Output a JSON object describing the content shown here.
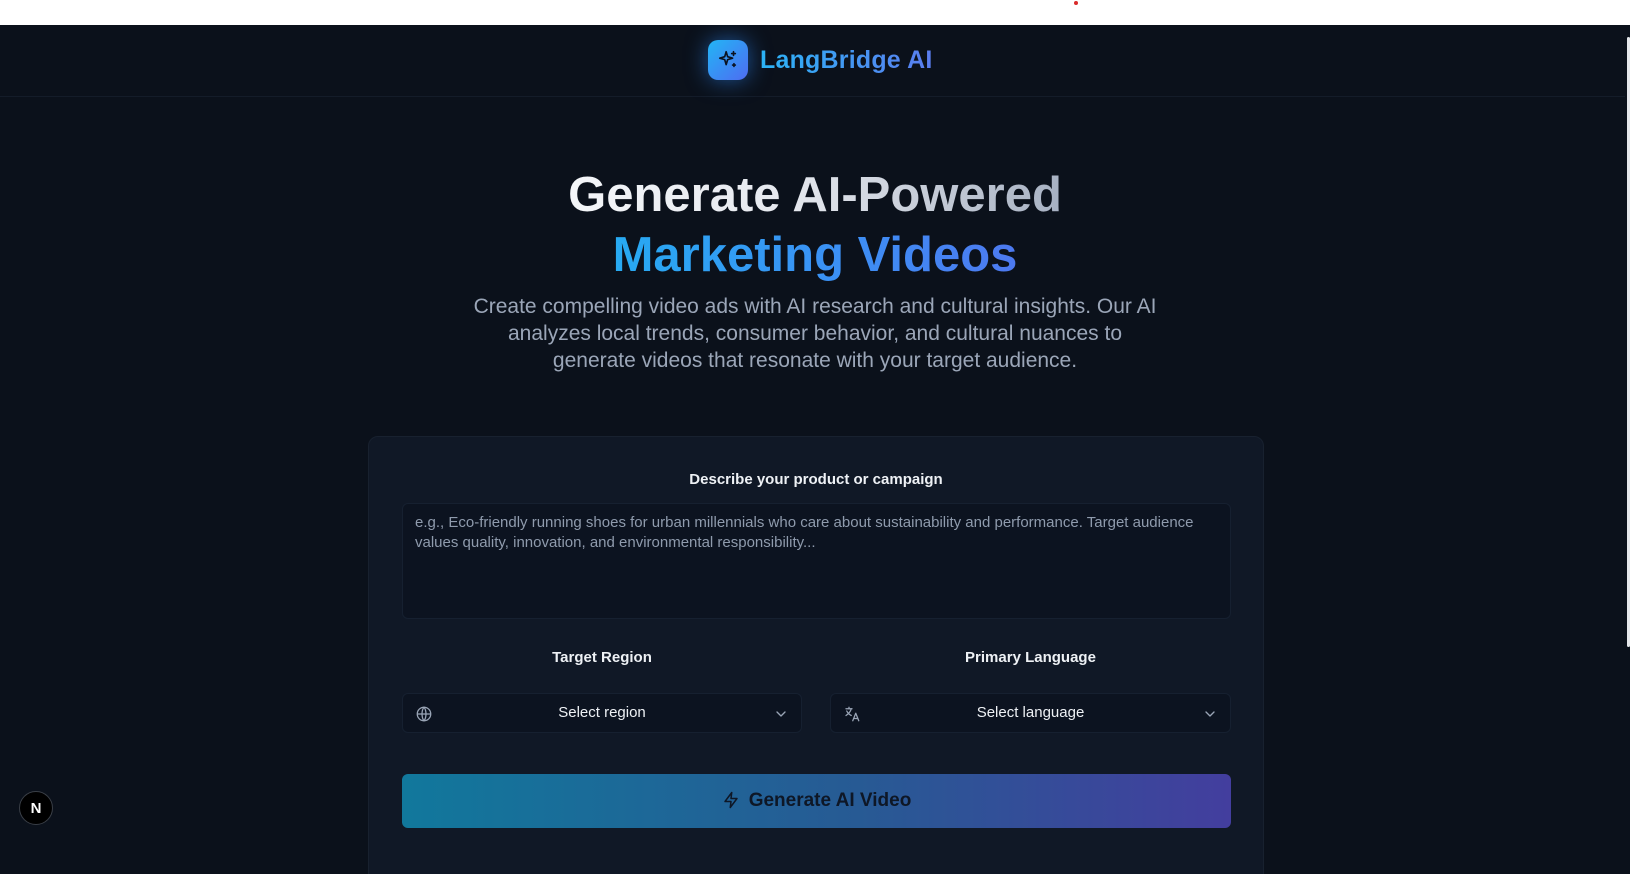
{
  "brand": {
    "name": "LangBridge AI",
    "logo_icon": "sparkles-icon",
    "accent_start": "#22b5f5",
    "accent_end": "#4e6cf2"
  },
  "hero": {
    "title_line1": "Generate AI-Powered",
    "title_line2": "Marketing Videos",
    "description": "Create compelling video ads with AI research and cultural insights. Our AI analyzes local trends, consumer behavior, and cultural nuances to generate videos that resonate with your target audience."
  },
  "form": {
    "description_label": "Describe your product or campaign",
    "description_placeholder": "e.g., Eco-friendly running shoes for urban millennials who care about sustainability and performance. Target audience values quality, innovation, and environmental responsibility...",
    "description_value": "",
    "region_label": "Target Region",
    "region_placeholder": "Select region",
    "region_icon": "globe-icon",
    "language_label": "Primary Language",
    "language_placeholder": "Select language",
    "language_icon": "translate-icon",
    "generate_label": "Generate AI Video",
    "generate_icon": "zap-icon",
    "button_gradient": [
      "#11789c",
      "#275a94",
      "#433e9e"
    ]
  },
  "dev_badge": {
    "label": "N",
    "icon": "nextjs-logo-icon"
  },
  "theme": {
    "background": "#0b111b",
    "card_background": "#101826",
    "text_primary": "#eef1f5",
    "text_muted": "#9ba6b8"
  }
}
